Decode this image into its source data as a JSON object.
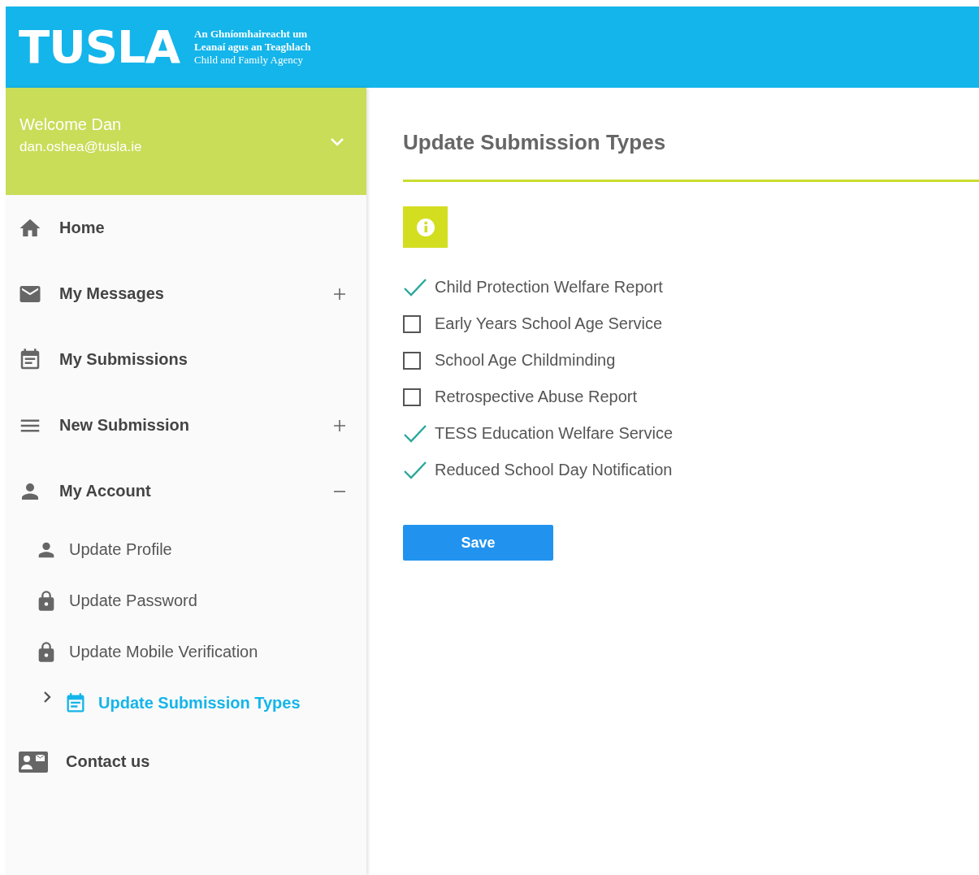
{
  "header": {
    "logo": "TUSLA",
    "tagline": [
      "An Ghníomhaireacht um",
      "Leanaí agus an Teaghlach",
      "Child and Family Agency"
    ]
  },
  "user": {
    "greeting": "Welcome Dan",
    "email": "dan.oshea@tusla.ie",
    "expanded": false
  },
  "sidebar": {
    "items": [
      {
        "label": "Home"
      },
      {
        "label": "My Messages",
        "expanded": false
      },
      {
        "label": "My Submissions"
      },
      {
        "label": "New Submission",
        "expanded": false
      },
      {
        "label": "My Account",
        "expanded": true,
        "children": [
          {
            "label": "Update Profile",
            "selected": false
          },
          {
            "label": "Update Password",
            "selected": false
          },
          {
            "label": "Update Mobile Verification",
            "selected": false
          },
          {
            "label": "Update Submission Types",
            "selected": true
          }
        ]
      },
      {
        "label": "Contact us"
      }
    ]
  },
  "main": {
    "title": "Update Submission Types",
    "options": [
      {
        "label": "Child Protection Welfare Report",
        "checked": true
      },
      {
        "label": "Early Years School Age Service",
        "checked": false
      },
      {
        "label": "School Age Childminding",
        "checked": false
      },
      {
        "label": "Retrospective Abuse Report",
        "checked": false
      },
      {
        "label": "TESS Education Welfare Service",
        "checked": true
      },
      {
        "label": "Reduced School Day Notification",
        "checked": true
      }
    ],
    "save_button": "Save"
  }
}
